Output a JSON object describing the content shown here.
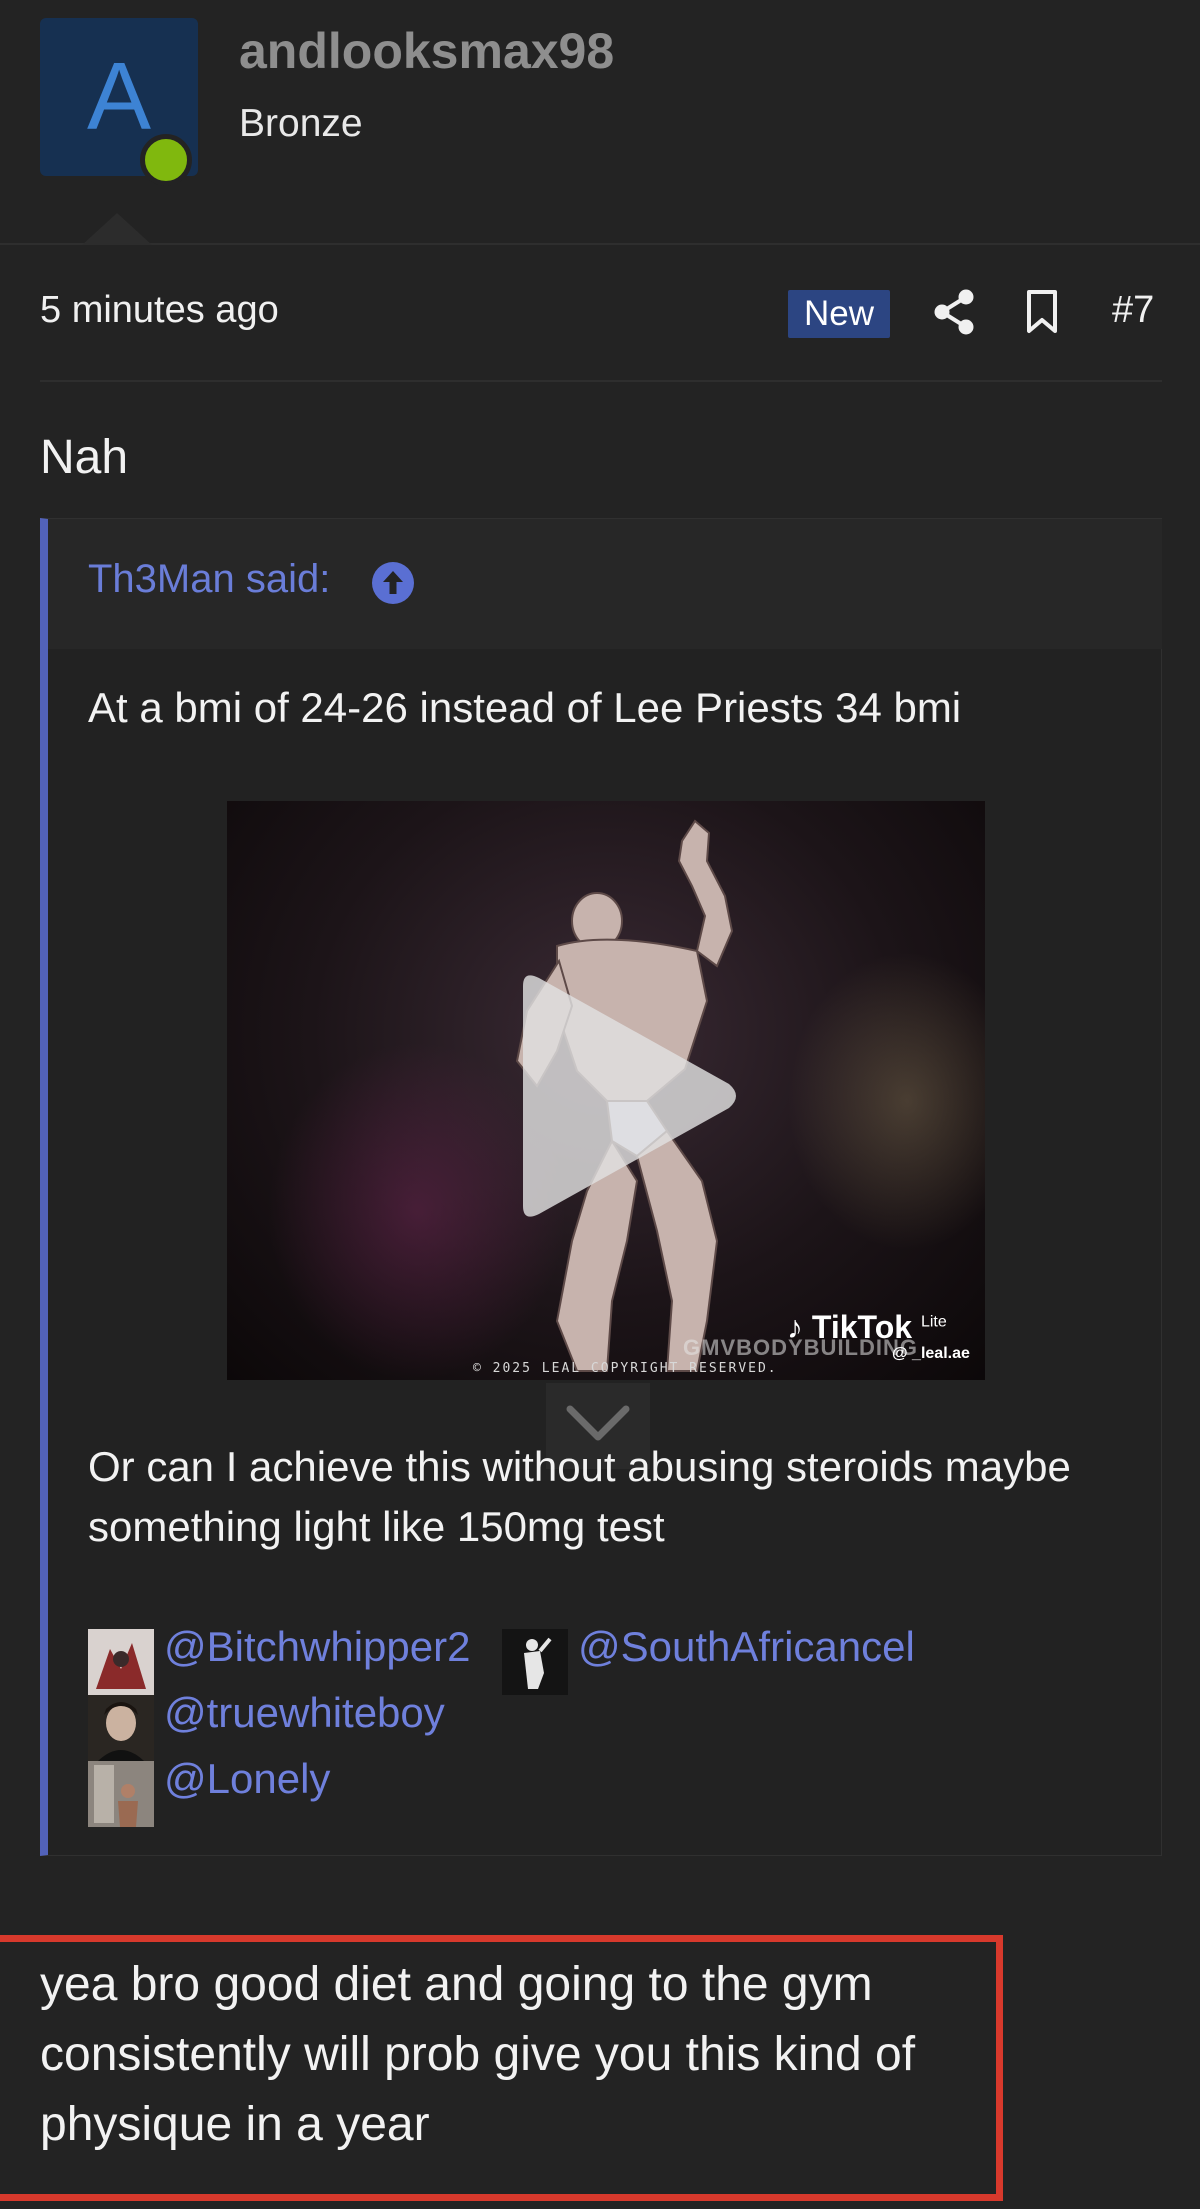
{
  "user": {
    "avatar_letter": "A",
    "username": "andlooksmax98",
    "rank": "Bronze",
    "online": true
  },
  "post_meta": {
    "time": "5 minutes ago",
    "badge": "New",
    "post_number": "#7"
  },
  "post": {
    "intro": "Nah",
    "quote": {
      "author": "Th3Man said:",
      "line1": "At a bmi of 24-26 instead of Lee Priests 34 bmi",
      "video": {
        "brand": "TikTok",
        "brand_suffix": "Lite",
        "watermark": "GMVBODYBUILDING",
        "handle": "@ _leal.ae",
        "copyright": "© 2025 LEAL COPYRIGHT RESERVED."
      },
      "line2": "Or can I achieve this without abusing steroids maybe something light like 150mg test",
      "mentions": [
        "@Bitchwhipper2",
        "@SouthAfricancel",
        "@truewhiteboy",
        "@Lonely"
      ]
    },
    "reply": "yea bro good diet and going to the gym consistently will prob give you this kind of physique in a year"
  },
  "colors": {
    "background": "#232323",
    "accent": "#6a7dd8",
    "new_badge": "#2c4582",
    "online": "#80b80e",
    "highlight_box": "#d7392c"
  },
  "icons": {
    "share": "share-icon",
    "bookmark": "bookmark-icon",
    "quote_jump": "arrow-circle-up-icon",
    "play": "play-icon",
    "expand": "chevron-down-icon"
  }
}
